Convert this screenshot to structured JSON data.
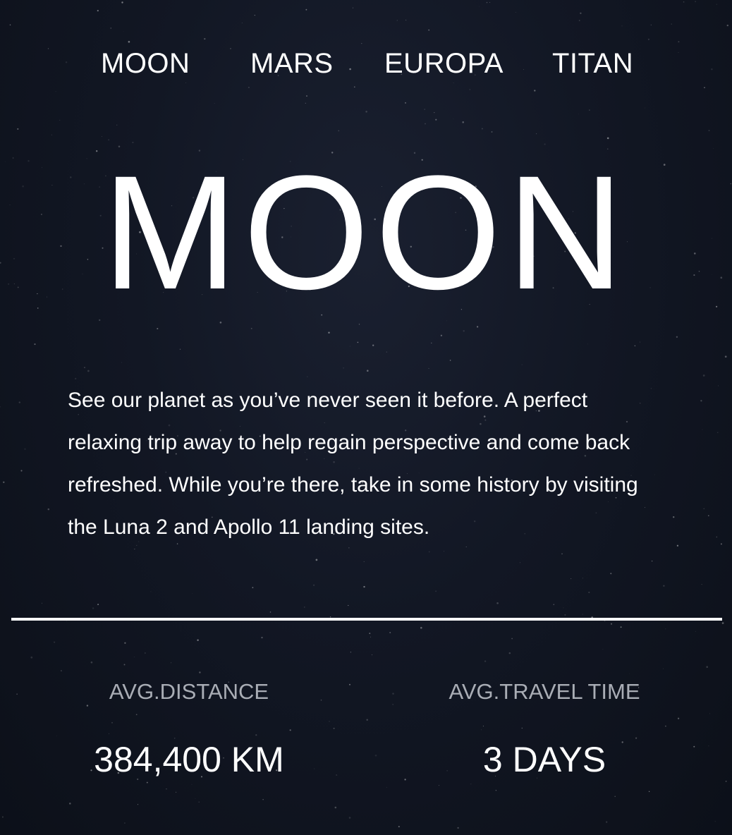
{
  "nav": {
    "items": [
      {
        "label": "MOON"
      },
      {
        "label": "MARS"
      },
      {
        "label": "EUROPA"
      },
      {
        "label": "TITAN"
      }
    ]
  },
  "hero": {
    "title": "MOON",
    "description": "See our planet as you’ve never seen it before. A perfect relaxing trip away to help regain perspective and come back refreshed. While you’re there, take in some history by visiting the Luna 2 and Apollo 11 landing sites."
  },
  "stats": {
    "distance": {
      "label": "AVG.DISTANCE",
      "value": "384,400 KM"
    },
    "travel": {
      "label": "AVG.TRAVEL TIME",
      "value": "3 DAYS"
    }
  },
  "colors": {
    "background": "#121724",
    "text": "#ffffff",
    "muted": "#a9adb5"
  }
}
